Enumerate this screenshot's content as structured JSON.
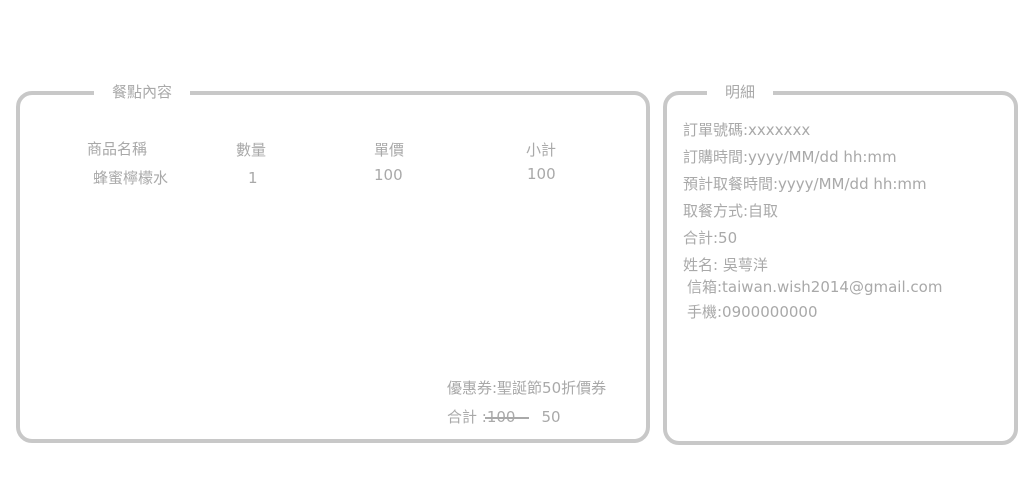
{
  "order": {
    "title": "餐點內容",
    "columns": [
      "商品名稱",
      "數量",
      "單價",
      "小計"
    ],
    "items": [
      {
        "name": "蜂蜜檸檬水",
        "qty": "1",
        "price": "100",
        "subtotal": "100"
      }
    ],
    "coupon": "優惠券:聖誕節50折價券",
    "total_label": "合計 :",
    "original_total": "100",
    "final_total": "50"
  },
  "details": {
    "title": "明細",
    "lines": [
      "訂單號碼:xxxxxxx",
      "訂購時間:yyyy/MM/dd hh:mm",
      "預計取餐時間:yyyy/MM/dd hh:mm",
      "取餐方式:自取",
      "合計:50",
      "姓名: 吳萼洋",
      "信箱:taiwan.wish2014@gmail.com",
      "手機:0900000000"
    ]
  }
}
